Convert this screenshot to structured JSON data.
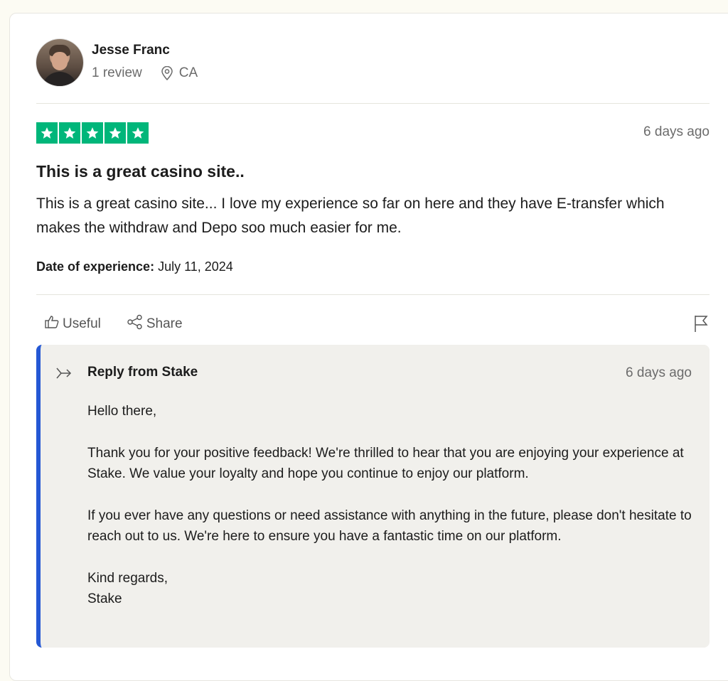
{
  "reviewer": {
    "name": "Jesse Franc",
    "review_count": "1 review",
    "location": "CA"
  },
  "review": {
    "rating": 5,
    "date": "6 days ago",
    "title": "This is a great casino site..",
    "body": "This is a great casino site... I love my experience so far on here and they have E-transfer which makes the withdraw and Depo soo much easier for me.",
    "experience_label": "Date of experience:",
    "experience_date": "July 11, 2024",
    "star_color": "#00b67a"
  },
  "actions": {
    "useful_label": "Useful",
    "share_label": "Share"
  },
  "reply": {
    "title": "Reply from Stake",
    "date": "6 days ago",
    "accent_color": "#2558d4",
    "paragraphs": [
      "Hello there,",
      "Thank you for your positive feedback! We're thrilled to hear that you are enjoying your experience at Stake. We value your loyalty and hope you continue to enjoy our platform.",
      "If you ever have any questions or need assistance with anything in the future, please don't hesitate to reach out to us. We're here to ensure you have a fantastic time on our platform."
    ],
    "sign_off": "Kind regards,",
    "signature": "Stake"
  }
}
